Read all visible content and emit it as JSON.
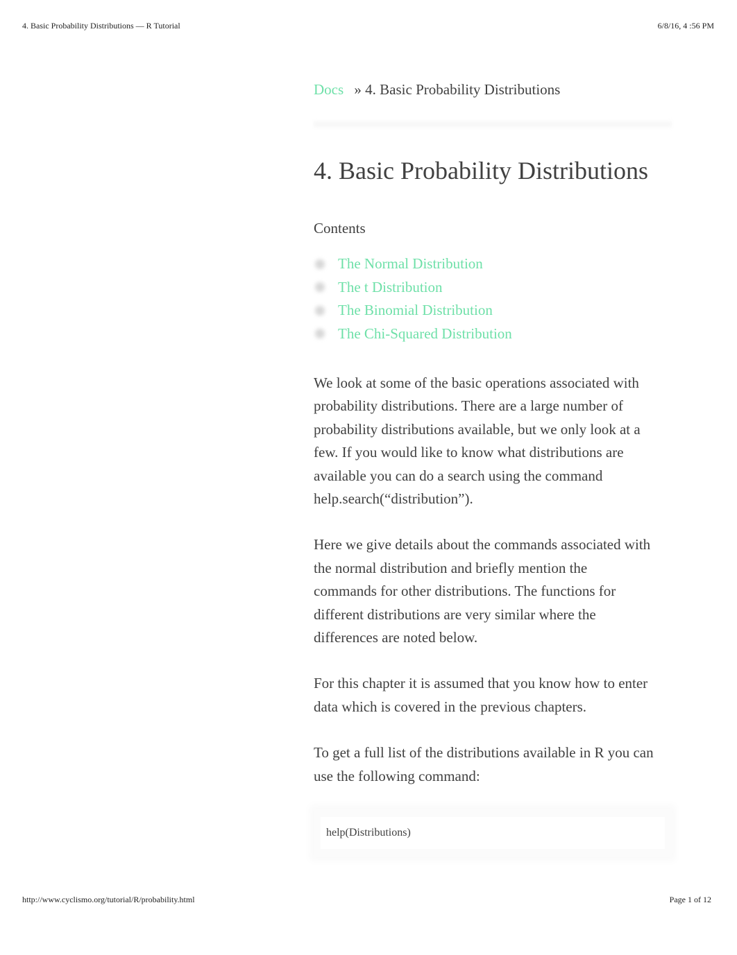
{
  "print_header": {
    "title": "4. Basic Probability Distributions — R Tutorial",
    "datetime": "6/8/16, 4  :56 PM"
  },
  "breadcrumb": {
    "root_label": "Docs",
    "separator": "»",
    "current": "4. Basic Probability Distributions"
  },
  "page_title": "4. Basic Probability Distributions",
  "contents": {
    "title": "Contents",
    "items": [
      {
        "label": "The Normal Distribution"
      },
      {
        "label": "The t Distribution"
      },
      {
        "label": "The Binomial Distribution"
      },
      {
        "label": "The Chi-Squared Distribution"
      }
    ]
  },
  "paragraphs": [
    "We look at some of the basic operations associated with probability distributions. There are a large number of probability distributions available, but we only look at a few. If you would like to know what distributions are available you can do a search using the command help.search(“distribution”).",
    "Here we give details about the commands associated with the normal distribution and briefly mention the commands for other distributions. The functions for different distributions are very similar where the differences are noted below.",
    "For this chapter it is assumed that you know how to enter data which is covered in the previous chapters.",
    "To get a full list of the distributions available in R you can use the following command:"
  ],
  "code_block": "help(Distributions)",
  "print_footer": {
    "url": "http://www.cyclismo.org/tutorial/R/probability.html",
    "page": "Page 1 of 12"
  }
}
